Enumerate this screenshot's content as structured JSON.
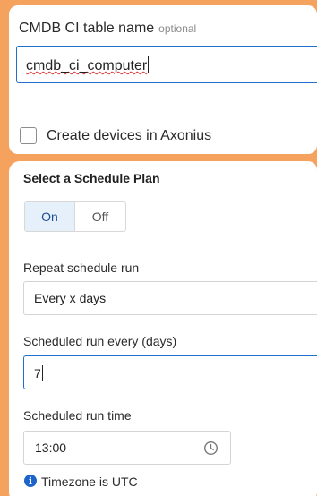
{
  "cmdb": {
    "label": "CMDB CI table name",
    "optional": "optional",
    "value": "cmdb_ci_computer"
  },
  "create_devices": {
    "label": "Create devices in Axonius",
    "checked": false
  },
  "schedule": {
    "title": "Select a Schedule Plan",
    "toggle_on": "On",
    "toggle_off": "Off",
    "selected": "On",
    "repeat_label": "Repeat schedule run",
    "repeat_value": "Every x days",
    "every_label": "Scheduled run every (days)",
    "every_value": "7",
    "time_label": "Scheduled run time",
    "time_value": "13:00",
    "timezone_note": "Timezone is UTC"
  },
  "icons": {
    "clock": "clock-icon",
    "info": "info-icon"
  },
  "colors": {
    "background": "#f5a25f",
    "accent": "#1f6fd1",
    "info": "#1c64c9"
  }
}
